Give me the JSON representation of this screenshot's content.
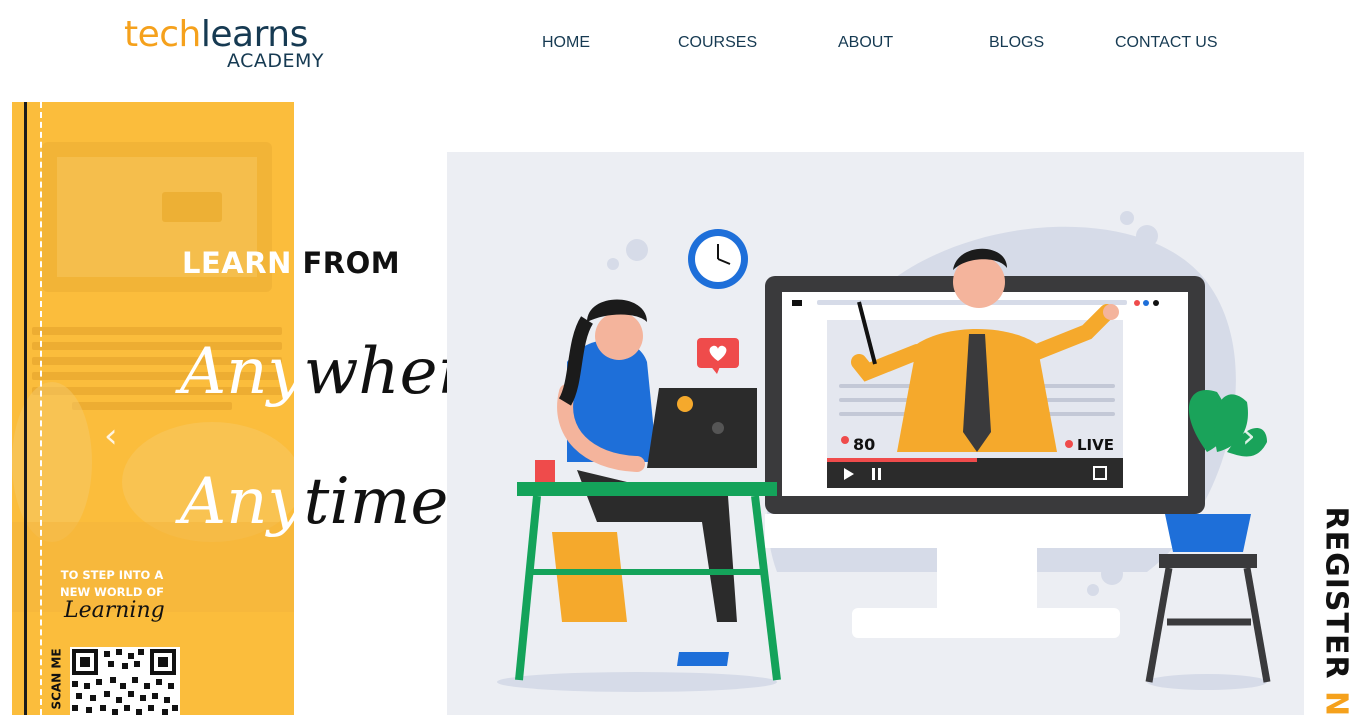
{
  "header": {
    "logo": {
      "part1": "tech",
      "part2": "learns",
      "sub": "ACADEMY"
    },
    "nav": [
      {
        "label": "HOME"
      },
      {
        "label": "COURSES"
      },
      {
        "label": "ABOUT"
      },
      {
        "label": "BLOGS"
      },
      {
        "label": "CONTACT US"
      }
    ]
  },
  "hero": {
    "headline_white": "LEARN",
    "headline_dark": "FROM",
    "script_line1_white": "Any",
    "script_line1_dark": "where",
    "script_line2_white": "Any",
    "script_line2_dark": "time",
    "promo_line1": "TO STEP INTO A",
    "promo_line2": "NEW WORLD OF",
    "promo_script": "Learning",
    "scan_label": "SCAN ME",
    "prev_arrow": "‹",
    "next_arrow": "›",
    "colors": {
      "accent": "#f5a11c",
      "banner": "#fbbd3c",
      "navy": "#163a52"
    }
  },
  "illustration": {
    "viewer_count": "80",
    "live_label": "LIVE"
  },
  "register": {
    "part1": "REGISTER ",
    "part2": "NO"
  }
}
